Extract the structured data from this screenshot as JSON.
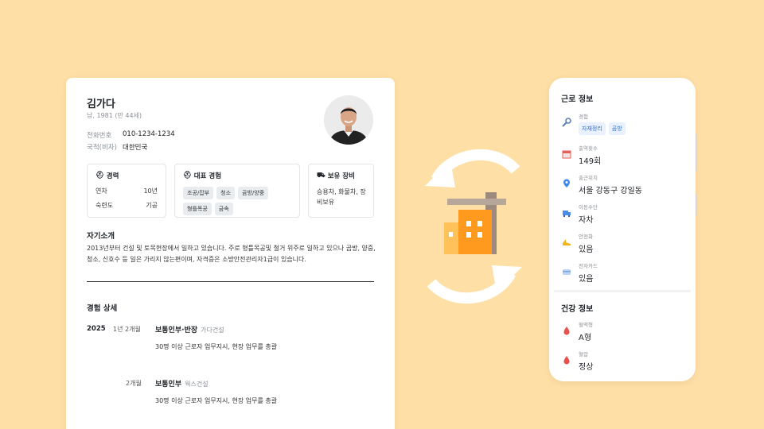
{
  "resume": {
    "name": "김가다",
    "meta": "남, 1981 (만 44세)",
    "phone_label": "전화번호",
    "phone_value": "010-1234-1234",
    "nation_label": "국적(비자)",
    "nation_value": "대한민국",
    "career_box": {
      "title": "경력",
      "rows": [
        {
          "k": "연차",
          "v": "10년"
        },
        {
          "k": "숙련도",
          "v": "기공"
        }
      ]
    },
    "main_exp_box": {
      "title": "대표 경험",
      "chips": [
        "조공/잡부",
        "청소",
        "곰방/양중",
        "형틀목공",
        "금속"
      ]
    },
    "equip_box": {
      "title": "보유 장비",
      "text": "승용차, 화물차, 장비보유"
    },
    "intro_title": "자기소개",
    "intro_text": "2013년부터 건설 및 토목현장에서 일하고 있습니다. 주로 형틀목공및 철거 위주로 일하고 있으나 곰방, 양중, 청소, 신호수 등 일은 가리지 않는편이며, 자격증은 소방안전관리자1급이 있습니다.",
    "exp_title": "경험 상세",
    "experiences": [
      {
        "year": "2025",
        "duration": "1년 2개월",
        "role": "보통인부·반장",
        "company": "가다건설",
        "desc": "30명 이상 근로자 업무지시, 현장 업무를 총괄"
      },
      {
        "year": "",
        "duration": "2개월",
        "role": "보통인부",
        "company": "웍스건설",
        "desc": "30명 이상 근로자 업무지시, 현장 업무를 총괄"
      }
    ]
  },
  "phone": {
    "work_title": "근로 정보",
    "work_rows": [
      {
        "icon": "wrench-icon",
        "label": "경험",
        "chips": [
          "자재정리",
          "곰방"
        ]
      },
      {
        "icon": "calendar-icon",
        "label": "출역횟수",
        "value": "149회"
      },
      {
        "icon": "location-pin-icon",
        "label": "출근위치",
        "value": "서울 강동구 강일동"
      },
      {
        "icon": "truck-icon",
        "label": "이동수단",
        "value": "자차"
      },
      {
        "icon": "safety-helmet-icon",
        "label": "안전화",
        "value": "있음"
      },
      {
        "icon": "id-card-icon",
        "label": "전자카드",
        "value": "있음"
      }
    ],
    "health_title": "건강 정보",
    "health_rows": [
      {
        "icon": "blood-drop-icon",
        "label": "혈액형",
        "value": "A형"
      },
      {
        "icon": "blood-drop-icon",
        "label": "혈압",
        "value": "정상"
      }
    ]
  },
  "colors": {
    "background": "#FEDFA6",
    "chip_blue": "#2f6fcf",
    "building_orange": "#FF9A1F"
  }
}
